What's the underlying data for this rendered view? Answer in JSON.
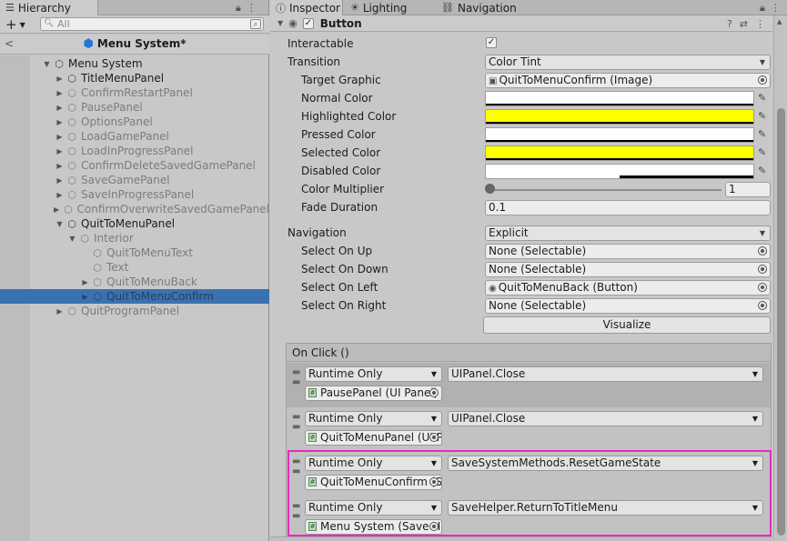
{
  "hierarchy": {
    "tab_label": "Hierarchy",
    "search_placeholder": "All",
    "scene_title": "Menu System*",
    "items": [
      {
        "label": "Menu System",
        "depth": 0,
        "arrow": "▼",
        "dim": false
      },
      {
        "label": "TitleMenuPanel",
        "depth": 1,
        "arrow": "▶",
        "dim": false
      },
      {
        "label": "ConfirmRestartPanel",
        "depth": 1,
        "arrow": "▶",
        "dim": true
      },
      {
        "label": "PausePanel",
        "depth": 1,
        "arrow": "▶",
        "dim": true
      },
      {
        "label": "OptionsPanel",
        "depth": 1,
        "arrow": "▶",
        "dim": true
      },
      {
        "label": "LoadGamePanel",
        "depth": 1,
        "arrow": "▶",
        "dim": true
      },
      {
        "label": "LoadInProgressPanel",
        "depth": 1,
        "arrow": "▶",
        "dim": true
      },
      {
        "label": "ConfirmDeleteSavedGamePanel",
        "depth": 1,
        "arrow": "▶",
        "dim": true
      },
      {
        "label": "SaveGamePanel",
        "depth": 1,
        "arrow": "▶",
        "dim": true
      },
      {
        "label": "SaveInProgressPanel",
        "depth": 1,
        "arrow": "▶",
        "dim": true
      },
      {
        "label": "ConfirmOverwriteSavedGamePanel",
        "depth": 1,
        "arrow": "▶",
        "dim": true
      },
      {
        "label": "QuitToMenuPanel",
        "depth": 1,
        "arrow": "▼",
        "dim": false
      },
      {
        "label": "Interior",
        "depth": 2,
        "arrow": "▼",
        "dim": true
      },
      {
        "label": "QuitToMenuText",
        "depth": 3,
        "arrow": "",
        "dim": true
      },
      {
        "label": "Text",
        "depth": 3,
        "arrow": "",
        "dim": true
      },
      {
        "label": "QuitToMenuBack",
        "depth": 3,
        "arrow": "▶",
        "dim": true
      },
      {
        "label": "QuitToMenuConfirm",
        "depth": 3,
        "arrow": "▶",
        "dim": true,
        "selected": true
      },
      {
        "label": "QuitProgramPanel",
        "depth": 1,
        "arrow": "▶",
        "dim": true
      }
    ]
  },
  "inspector": {
    "tabs": [
      {
        "label": "Inspector",
        "glyph": "ⓘ"
      },
      {
        "label": "Lighting",
        "glyph": "☀"
      },
      {
        "label": "Navigation",
        "glyph": "⛓"
      }
    ],
    "component_name": "Button",
    "interactable_label": "Interactable",
    "interactable_check": "✓",
    "transition_label": "Transition",
    "transition_value": "Color Tint",
    "target_graphic_label": "Target Graphic",
    "target_graphic_value": "QuitToMenuConfirm (Image)",
    "colors": [
      {
        "label": "Normal Color",
        "color": "#ffffff",
        "alpha_fraction": 0
      },
      {
        "label": "Highlighted Color",
        "color": "#ffff00",
        "alpha_fraction": 0
      },
      {
        "label": "Pressed Color",
        "color": "#ffffff",
        "alpha_fraction": 0
      },
      {
        "label": "Selected Color",
        "color": "#ffff00",
        "alpha_fraction": 0
      },
      {
        "label": "Disabled Color",
        "color": "#ffffff",
        "alpha_fraction": 0.5
      }
    ],
    "color_multiplier_label": "Color Multiplier",
    "color_multiplier_value": "1",
    "fade_duration_label": "Fade Duration",
    "fade_duration_value": "0.1",
    "navigation_label": "Navigation",
    "navigation_value": "Explicit",
    "select_on_up_label": "Select On Up",
    "select_on_up_value": "None (Selectable)",
    "select_on_down_label": "Select On Down",
    "select_on_down_value": "None (Selectable)",
    "select_on_left_label": "Select On Left",
    "select_on_left_value": "QuitToMenuBack (Button)",
    "select_on_right_label": "Select On Right",
    "select_on_right_value": "None (Selectable)",
    "visualize_label": "Visualize",
    "onclick_header": "On Click ()",
    "onclick_entries": [
      {
        "runtime": "Runtime Only",
        "function": "UIPanel.Close",
        "object": "PausePanel (UI Panel)"
      },
      {
        "runtime": "Runtime Only",
        "function": "UIPanel.Close",
        "object": "QuitToMenuPanel (UI Panel)"
      },
      {
        "runtime": "Runtime Only",
        "function": "SaveSystemMethods.ResetGameState",
        "object": "QuitToMenuConfirm (Save System Methods)"
      },
      {
        "runtime": "Runtime Only",
        "function": "SaveHelper.ReturnToTitleMenu",
        "object": "Menu System (Save Helper)"
      }
    ]
  },
  "colors": {
    "selection": "#3a72b0",
    "highlight_border": "#e32cbe",
    "scene_icon": "#2574d8"
  }
}
